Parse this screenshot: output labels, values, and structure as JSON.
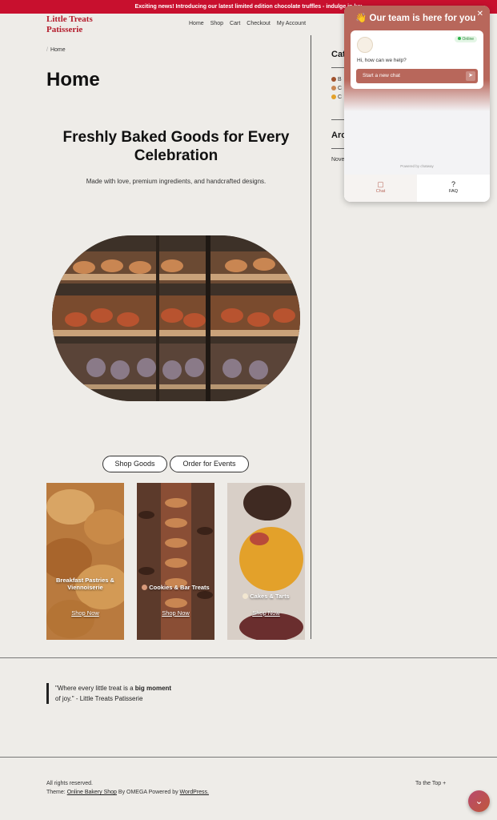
{
  "announcement": "Exciting news! Introducing our latest limited edition chocolate truffles - indulge in lux",
  "site": {
    "logo_line1": "Little Treats",
    "logo_line2": "Patisserie"
  },
  "nav": [
    "Home",
    "Shop",
    "Cart",
    "Checkout",
    "My Account"
  ],
  "breadcrumb": {
    "current": "Home"
  },
  "page_title": "Home",
  "hero": {
    "title": "Freshly Baked Goods for Every Celebration",
    "subtitle": "Made with love, premium ingredients, and handcrafted designs."
  },
  "buttons": {
    "shop_goods": "Shop Goods",
    "order_events": "Order for Events"
  },
  "cards": [
    {
      "title": "Breakfast Pastries & Viennoiserie",
      "link": "Shop Now"
    },
    {
      "title": "Cookies & Bar Treats",
      "link": "Shop Now"
    },
    {
      "title": "Cakes & Tarts",
      "link": "Shop Now"
    }
  ],
  "quote": {
    "before": "\"Where every little treat is a ",
    "bold": "big moment",
    "after": " of joy.\" - Little Treats Patisserie"
  },
  "footer": {
    "rights": "All rights reserved.",
    "theme_prefix": "Theme: ",
    "theme_link": "Online Bakery Shop",
    "by": " By OMEGA Powered by ",
    "wp_link": "WordPress.",
    "to_top": "To the Top +"
  },
  "sidebar": {
    "categories_title": "Cat",
    "items": [
      "B",
      "C",
      "C"
    ],
    "archives_title": "Arc",
    "archive_item": "Nove"
  },
  "chat": {
    "title": "Our team is here for you",
    "status": "Online",
    "greeting": "Hi, how can we help?",
    "start_button": "Start a new chat",
    "powered": "Powered by chatway",
    "tabs": [
      "Chat",
      "FAQ"
    ]
  },
  "colors": {
    "accent": "#b8675b",
    "announce": "#c8102e",
    "logo": "#b31b2b"
  }
}
